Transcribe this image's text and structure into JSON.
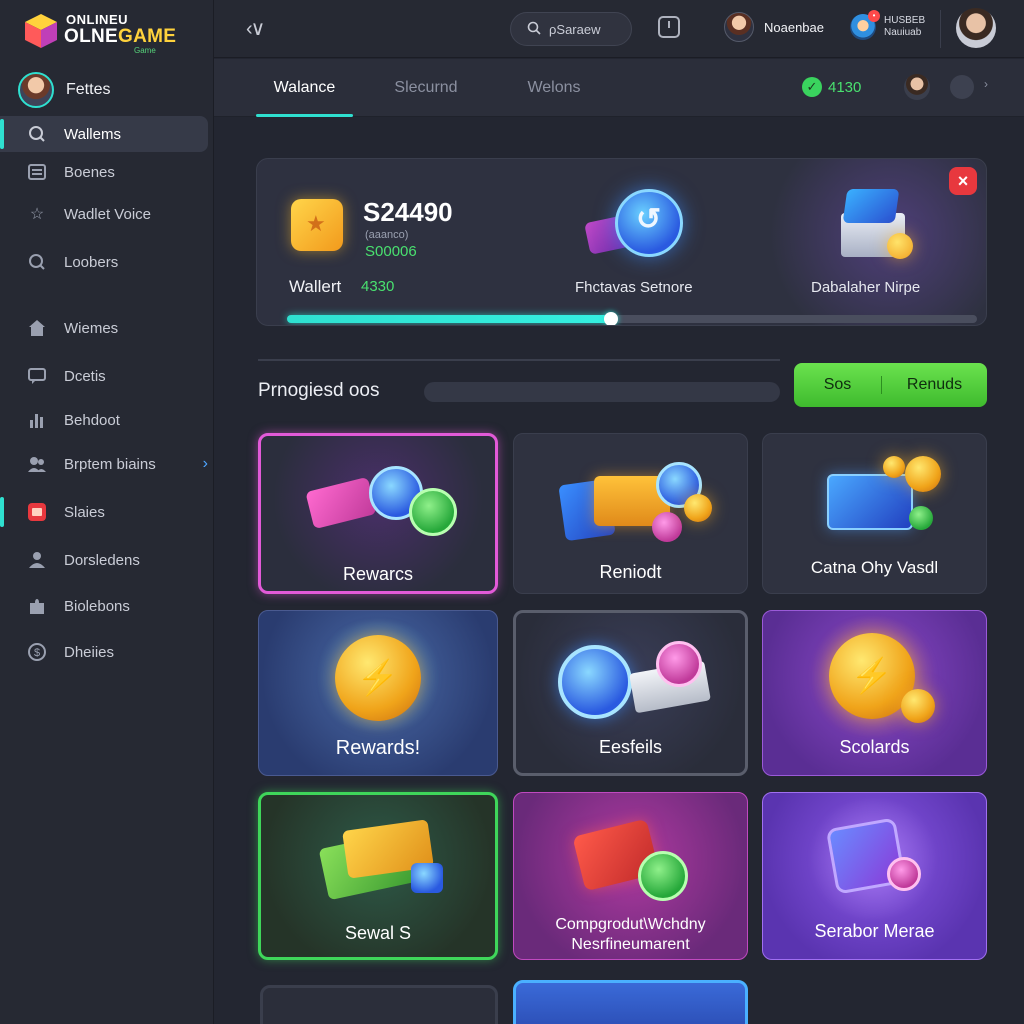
{
  "app": {
    "logo_line1": "ONLINEU",
    "logo_line2a": "OLNE",
    "logo_line2b": "GAME",
    "logo_line3": "Game"
  },
  "sidebar": {
    "profile_name": "Fettes",
    "items": [
      {
        "label": "Wallems",
        "icon": "search-icon",
        "active": true
      },
      {
        "label": "Boenes",
        "icon": "list-icon"
      },
      {
        "label": "Wadlet Voice",
        "icon": "star-icon"
      },
      {
        "label": "Loobers",
        "icon": "search-icon"
      },
      {
        "label": "Wiemes",
        "icon": "home-icon"
      },
      {
        "label": "Dcetis",
        "icon": "chat-icon"
      },
      {
        "label": "Behdoot",
        "icon": "chart-icon"
      },
      {
        "label": "Brptem biains",
        "icon": "users-icon",
        "has_chevron": true
      },
      {
        "label": "Slaies",
        "icon": "box-icon",
        "marker": true
      },
      {
        "label": "Dorsledens",
        "icon": "users-icon"
      },
      {
        "label": "Biolebons",
        "icon": "puzzle-icon"
      },
      {
        "label": "Dheiies",
        "icon": "dollar-icon"
      }
    ]
  },
  "topbar": {
    "search_placeholder": "ρSaraew",
    "user_name": "Noaenbae",
    "notif_line1": "HUSBEB",
    "notif_line2": "Nauiuab"
  },
  "tabs": {
    "items": [
      "Walance",
      "Slecurnd",
      "Welons"
    ],
    "active_index": 0,
    "balance": "4130"
  },
  "wallet": {
    "amount": "S24490",
    "sub_label": "(aaanco)",
    "sub_value": "S00006",
    "label": "Wallert",
    "label_value": "4330",
    "mid_label": "Fhctavas Setnore",
    "right_label": "Dabalaher Nirpe",
    "progress": 0.47,
    "colors": {
      "accent": "#2fe0d0",
      "positive": "#49e06f",
      "danger": "#e8383e"
    }
  },
  "section": {
    "title": "Prnogiesd oos",
    "button_left": "Sos",
    "button_right": "Renuds"
  },
  "tiles": [
    {
      "label": "Rewarcs",
      "theme": "dark-pink"
    },
    {
      "label": "Reniodt",
      "theme": "dark"
    },
    {
      "label": "Catna Ohy Vasdl",
      "theme": "dark"
    },
    {
      "label": "Rewards!",
      "theme": "blue"
    },
    {
      "label": "Eesfeils",
      "theme": "dark-gray"
    },
    {
      "label": "Scolards",
      "theme": "purple"
    },
    {
      "label": "Sewal S",
      "theme": "green"
    },
    {
      "label": "Compgrodut\\Wchdny\nNesrfineumarent",
      "theme": "magenta"
    },
    {
      "label": "Serabor Merae",
      "theme": "violet"
    }
  ]
}
